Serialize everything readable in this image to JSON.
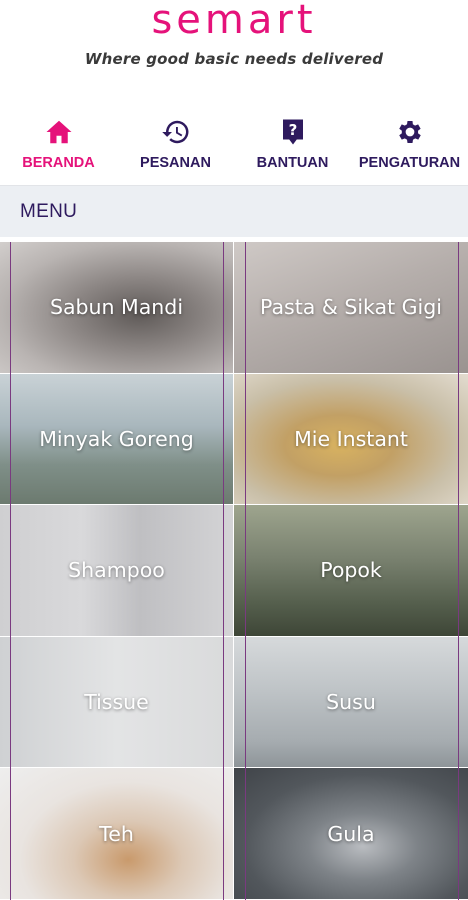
{
  "brand": {
    "logo": "semart",
    "tagline": "Where good basic needs delivered",
    "accent_color": "#e5127a",
    "nav_color": "#2e1a5e"
  },
  "nav": {
    "items": [
      {
        "label": "BERANDA",
        "icon": "home-icon",
        "active": true
      },
      {
        "label": "PESANAN",
        "icon": "history-icon",
        "active": false
      },
      {
        "label": "BANTUAN",
        "icon": "help-icon",
        "active": false
      },
      {
        "label": "PENGATURAN",
        "icon": "gear-icon",
        "active": false
      }
    ]
  },
  "menu": {
    "title": "MENU",
    "items": [
      {
        "label": "Sabun Mandi"
      },
      {
        "label": "Pasta & Sikat Gigi"
      },
      {
        "label": "Minyak Goreng"
      },
      {
        "label": "Mie Instant"
      },
      {
        "label": "Shampoo"
      },
      {
        "label": "Popok"
      },
      {
        "label": "Tissue"
      },
      {
        "label": "Susu"
      },
      {
        "label": "Teh"
      },
      {
        "label": "Gula"
      }
    ]
  }
}
